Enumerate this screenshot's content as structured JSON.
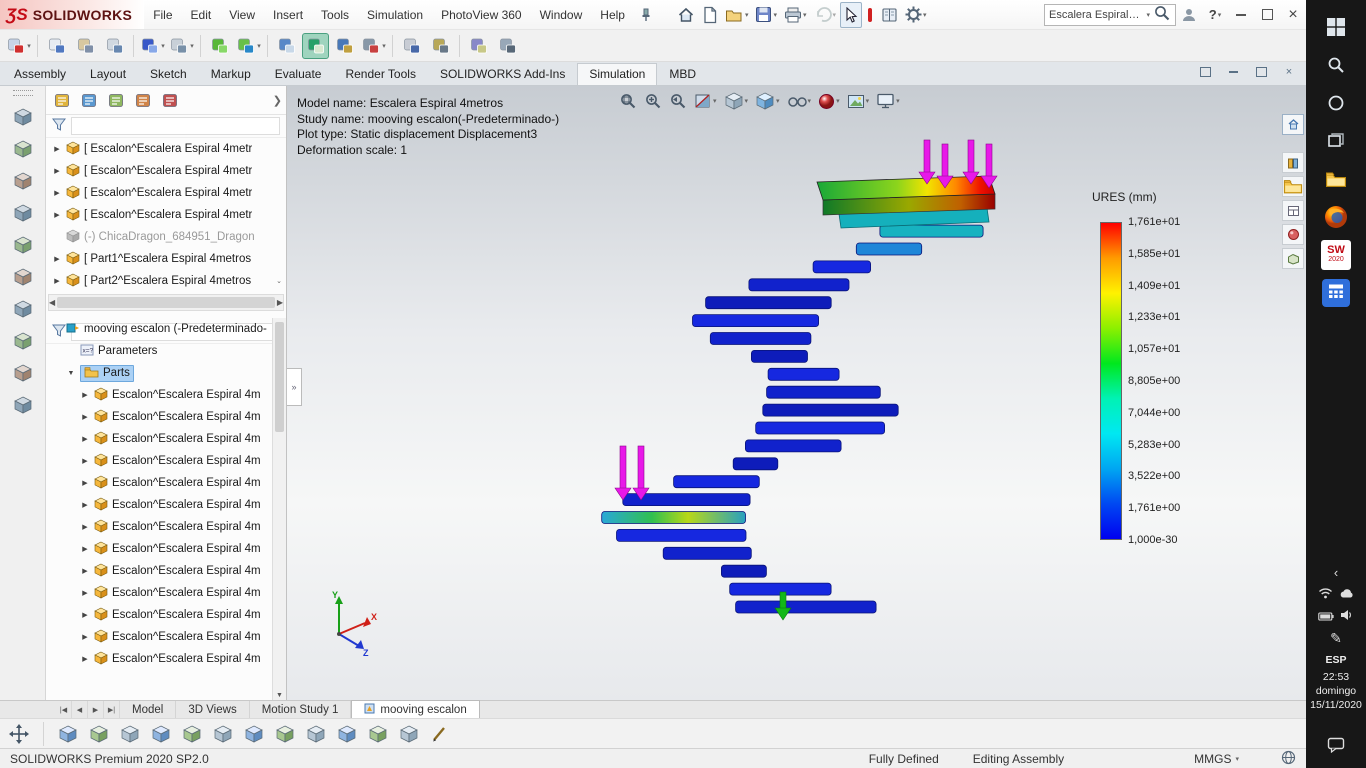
{
  "titlebar": {
    "logo_mark": "ƷS",
    "brand": "SOLIDWORKS",
    "menus": [
      "File",
      "Edit",
      "View",
      "Insert",
      "Tools",
      "Simulation",
      "PhotoView 360",
      "Window",
      "Help"
    ],
    "search_value": "Escalera Espiral 4...",
    "qa_icons": [
      {
        "name": "home-icon"
      },
      {
        "name": "new-document-icon"
      },
      {
        "name": "open-icon",
        "chevron": true
      },
      {
        "name": "save-icon",
        "chevron": true
      },
      {
        "name": "print-icon",
        "chevron": true
      },
      {
        "name": "undo-icon",
        "chevron": true,
        "disabled": true
      },
      {
        "name": "select-cursor-icon",
        "boxed": true
      },
      {
        "name": "appearance-pill-icon"
      },
      {
        "name": "design-journal-icon"
      },
      {
        "name": "options-gear-icon",
        "chevron": true
      }
    ],
    "help_label": "?"
  },
  "toolbar2": [
    {
      "name": "magnifier-edit-icon",
      "c": "#c8d4e8",
      "c2": "#d03030",
      "chevron": true
    },
    {
      "sep": true
    },
    {
      "name": "command-list-icon",
      "c": "#e8ecf2",
      "c2": "#5078c0"
    },
    {
      "name": "design-binder-icon",
      "c": "#d8c8a0",
      "c2": "#8090a8"
    },
    {
      "name": "file-properties-icon",
      "c": "#d0d8e0",
      "c2": "#6888b0"
    },
    {
      "sep": true
    },
    {
      "name": "import-arrow-icon",
      "c": "#3858c8",
      "c2": "#88a8e8",
      "chevron": true
    },
    {
      "name": "table-columns-icon",
      "c": "#c8d0d8",
      "c2": "#7890a8",
      "chevron": true
    },
    {
      "sep": true
    },
    {
      "name": "revolve-tool-icon",
      "c": "#58b838",
      "c2": "#88d868"
    },
    {
      "name": "extrude-tool-icon",
      "c": "#68c048",
      "c2": "#2888c8",
      "chevron": true
    },
    {
      "sep": true
    },
    {
      "name": "component-move-icon",
      "c": "#5888c8",
      "c2": "#c8d8e8"
    },
    {
      "name": "active-tool-icon",
      "c": "#28a068",
      "c2": "#d8e8d0",
      "active": true
    },
    {
      "name": "exploded-view-icon",
      "c": "#4878b8",
      "c2": "#c0a040"
    },
    {
      "name": "interference-detection-icon",
      "c": "#8898a8",
      "c2": "#c84040",
      "chevron": true
    },
    {
      "sep": true
    },
    {
      "name": "evaluate-report-icon",
      "c": "#c8ccd4",
      "c2": "#4868a8"
    },
    {
      "name": "measure-tool-icon",
      "c": "#b8a858",
      "c2": "#687888"
    },
    {
      "sep": true
    },
    {
      "name": "pack-and-go-icon",
      "c": "#8888c8",
      "c2": "#c8c888"
    },
    {
      "name": "grid-overlay-icon",
      "c": "#98a8b8",
      "c2": "#586878"
    }
  ],
  "commandmanager": {
    "tabs": [
      "Assembly",
      "Layout",
      "Sketch",
      "Markup",
      "Evaluate",
      "Render Tools",
      "SOLIDWORKS Add-Ins",
      "Simulation",
      "MBD"
    ],
    "active": "Simulation"
  },
  "left_toolbar": [
    "insert-components-icon",
    "mate-icon",
    "component-pattern-icon",
    "smart-fasteners-icon",
    "move-component-icon",
    "show-hidden-components-icon",
    "assembly-features-icon",
    "reference-geometry-icon",
    "new-motion-study-icon",
    "bill-of-materials-icon"
  ],
  "featuremanager": {
    "tab_icons": [
      "featuremanager-design-tree-icon",
      "propertymanager-icon",
      "configurationmanager-icon",
      "dimxpertmanager-icon",
      "displaymanager-icon"
    ],
    "top_items": [
      {
        "label": "[ Escalon^Escalera Espiral 4metr",
        "icon": "part",
        "expander": true
      },
      {
        "label": "[ Escalon^Escalera Espiral 4metr",
        "icon": "part",
        "expander": true
      },
      {
        "label": "[ Escalon^Escalera Espiral 4metr",
        "icon": "part",
        "expander": true
      },
      {
        "label": "[ Escalon^Escalera Espiral 4metr",
        "icon": "part",
        "expander": true
      },
      {
        "label": "(-) ChicaDragon_684951_Dragon",
        "icon": "part-suppressed",
        "expander": false,
        "dim": true
      },
      {
        "label": "[ Part1^Escalera Espiral 4metros",
        "icon": "part",
        "expander": true
      },
      {
        "label": "[ Part2^Escalera Espiral 4metros",
        "icon": "part",
        "expander": true,
        "end_chevron": true
      }
    ],
    "study_root": {
      "label": "mooving escalon (-Predeterminado-",
      "icon": "simulation-study"
    },
    "study_items": [
      {
        "label": "Parameters",
        "icon": "parameters"
      },
      {
        "label": "Parts",
        "icon": "parts-folder",
        "selected": true,
        "expanded": true
      }
    ],
    "parts_items": [
      "Escalon^Escalera Espiral 4m",
      "Escalon^Escalera Espiral 4m",
      "Escalon^Escalera Espiral 4m",
      "Escalon^Escalera Espiral 4m",
      "Escalon^Escalera Espiral 4m",
      "Escalon^Escalera Espiral 4m",
      "Escalon^Escalera Espiral 4m",
      "Escalon^Escalera Espiral 4m",
      "Escalon^Escalera Espiral 4m",
      "Escalon^Escalera Espiral 4m",
      "Escalon^Escalera Espiral 4m",
      "Escalon^Escalera Espiral 4m",
      "Escalon^Escalera Espiral 4m"
    ]
  },
  "viewport": {
    "annotations": [
      "Model name: Escalera Espiral 4metros",
      "Study name: mooving escalon(-Predeterminado-)",
      "Plot type: Static displacement Displacement3",
      "Deformation scale: 1"
    ],
    "hud_icons": [
      {
        "name": "zoom-to-fit-icon"
      },
      {
        "name": "zoom-to-area-icon"
      },
      {
        "name": "previous-view-icon"
      },
      {
        "name": "section-view-icon",
        "chevron": true
      },
      {
        "name": "view-orientation-icon",
        "chevron": true
      },
      {
        "name": "display-style-icon",
        "chevron": true
      },
      {
        "name": "hide-show-items-icon",
        "chevron": true
      },
      {
        "name": "edit-appearance-icon",
        "chevron": true
      },
      {
        "name": "apply-scene-icon",
        "chevron": true
      },
      {
        "name": "view-settings-icon",
        "chevron": true
      }
    ]
  },
  "legend": {
    "title": "URES (mm)",
    "values": [
      "1,761e+01",
      "1,585e+01",
      "1,409e+01",
      "1,233e+01",
      "1,057e+01",
      "8,805e+00",
      "7,044e+00",
      "5,283e+00",
      "3,522e+00",
      "1,761e+00",
      "1,000e-30"
    ],
    "colors": [
      "#ff0000",
      "#ff9b00",
      "#fff200",
      "#8cf000",
      "#00e81e",
      "#00f2b4",
      "#00e8f2",
      "#00a6f2",
      "#0048f2",
      "#0000f0"
    ]
  },
  "taskpane_icons": [
    "solidworks-resources-icon",
    "design-library-icon",
    "file-explorer-icon",
    "view-palette-icon",
    "appearances-icon",
    "custom-properties-icon"
  ],
  "bottom_tabs": {
    "nav_icons": [
      "first-tab-icon",
      "previous-tab-icon",
      "next-tab-icon",
      "last-tab-icon"
    ],
    "tabs": [
      "Model",
      "3D Views",
      "Motion Study 1",
      "mooving escalon"
    ],
    "active": "mooving escalon"
  },
  "bottom_toolbar": [
    "3d-drawing-view-icon",
    "view-front-icon",
    "view-back-icon",
    "view-left-icon",
    "view-right-icon",
    "view-top-icon",
    "view-bottom-icon",
    "view-isometric-icon",
    "view-trimetric-icon",
    "view-dimetric-icon",
    "view-normal-to-icon",
    "view-single-icon",
    "view-linked-icon",
    "measure-stylus-icon"
  ],
  "statusbar": {
    "product": "SOLIDWORKS Premium 2020 SP2.0",
    "state": "Fully Defined",
    "mode": "Editing Assembly",
    "units": "MMGS"
  },
  "taskbar": {
    "app_icons": [
      "start-icon",
      "search-icon",
      "cortana-icon",
      "task-view-icon",
      "file-explorer-icon",
      "firefox-icon",
      "solidworks-2020-icon",
      "calculator-icon"
    ],
    "tray_icons": [
      "hidden-icons-icon",
      "wifi-icon",
      "cloud-icon",
      "battery-icon",
      "volume-icon",
      "pen-icon",
      "notification-icon"
    ],
    "language": "ESP",
    "time": "22:53",
    "weekday": "domingo",
    "date": "15/11/2020"
  }
}
